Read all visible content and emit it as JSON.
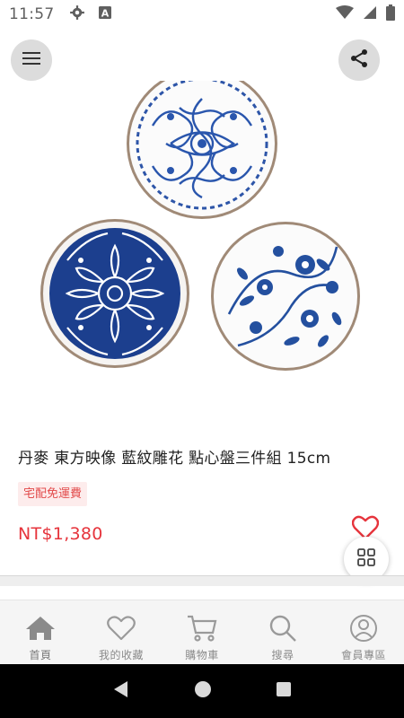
{
  "status_bar": {
    "time": "11:57",
    "icons": [
      "gear-icon",
      "a-box-icon",
      "wifi-icon",
      "signal-icon",
      "battery-icon"
    ]
  },
  "header": {
    "menu_icon": "hamburger-icon",
    "share_icon": "share-icon"
  },
  "product": {
    "title": "丹麥 東方映像 藍紋雕花 點心盤三件組 15cm",
    "shipping_tag": "宅配免運費",
    "price": "NT$1,380",
    "favorite_icon": "heart-outline-icon",
    "more_icon": "grid-icon"
  },
  "bottom_nav": {
    "items": [
      {
        "label": "首頁",
        "icon": "home-icon"
      },
      {
        "label": "我的收藏",
        "icon": "heart-icon"
      },
      {
        "label": "購物車",
        "icon": "cart-icon"
      },
      {
        "label": "搜尋",
        "icon": "search-icon"
      },
      {
        "label": "會員專區",
        "icon": "user-icon"
      }
    ]
  },
  "colors": {
    "price": "#e6343c",
    "tag_bg": "#fdecec",
    "plate_blue": "#1c3f8e",
    "nav_icon": "#9a9a9a"
  }
}
